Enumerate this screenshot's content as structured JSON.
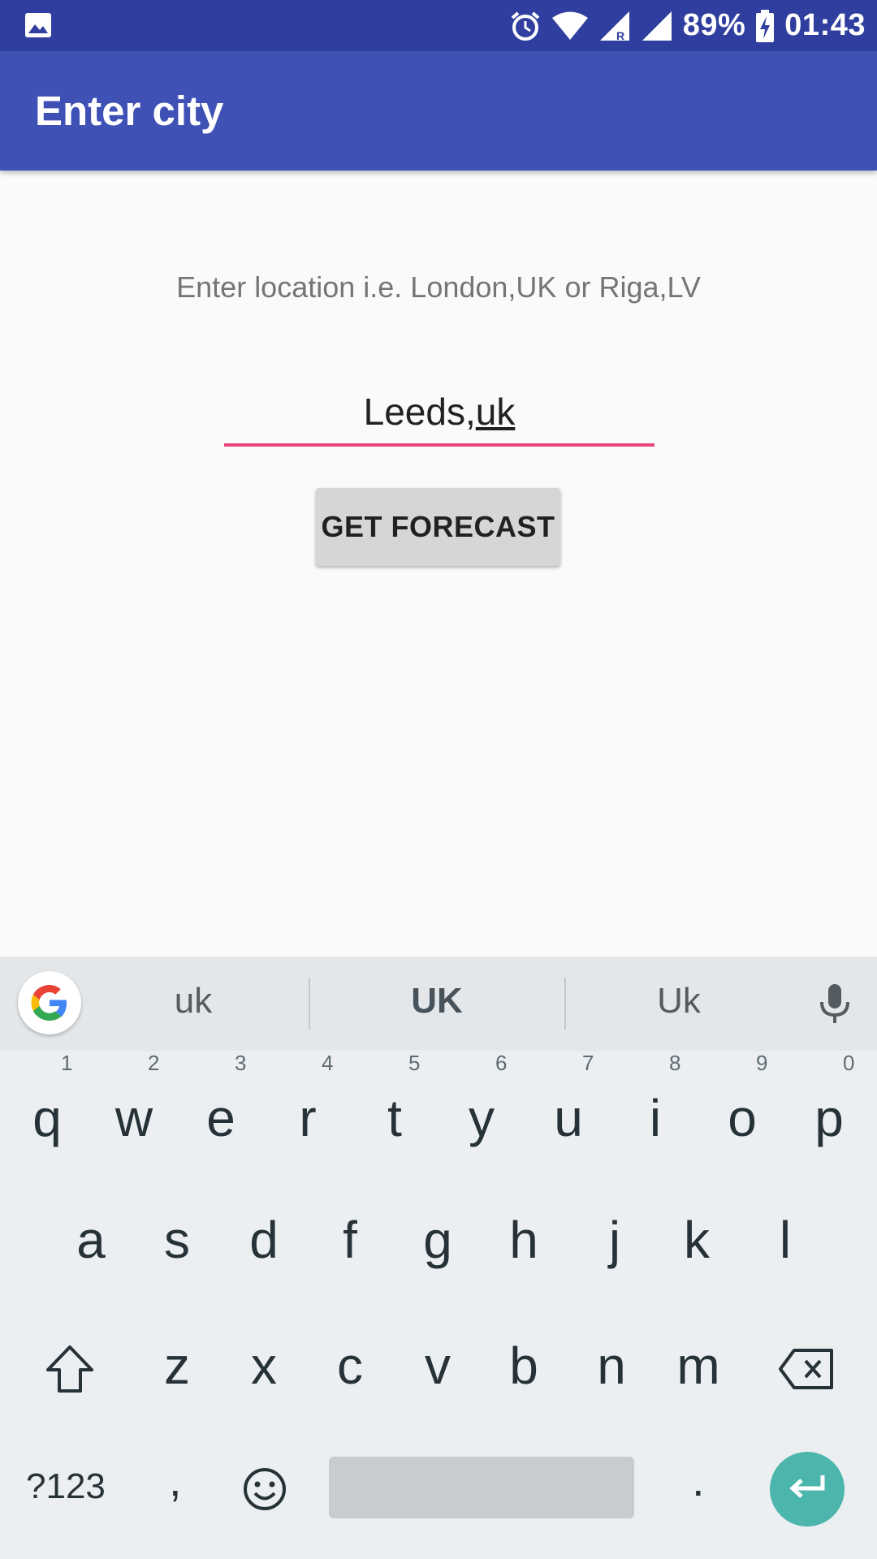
{
  "status_bar": {
    "battery": "89%",
    "time": "01:43",
    "icons": [
      "image-icon",
      "alarm-icon",
      "wifi-icon",
      "cell-signal-roaming-icon",
      "cell-signal-icon",
      "battery-charging-icon"
    ]
  },
  "app_bar": {
    "title": "Enter city"
  },
  "content": {
    "hint": "Enter location i.e. London,UK or Riga,LV",
    "input_value_prefix": "Leeds,",
    "input_value_composing": "uk",
    "forecast_button": "GET FORECAST",
    "accent_color": "#e8467a"
  },
  "keyboard": {
    "suggestions": [
      "uk",
      "UK",
      "Uk"
    ],
    "row1": [
      {
        "key": "q",
        "num": "1"
      },
      {
        "key": "w",
        "num": "2"
      },
      {
        "key": "e",
        "num": "3"
      },
      {
        "key": "r",
        "num": "4"
      },
      {
        "key": "t",
        "num": "5"
      },
      {
        "key": "y",
        "num": "6"
      },
      {
        "key": "u",
        "num": "7"
      },
      {
        "key": "i",
        "num": "8"
      },
      {
        "key": "o",
        "num": "9"
      },
      {
        "key": "p",
        "num": "0"
      }
    ],
    "row2": [
      "a",
      "s",
      "d",
      "f",
      "g",
      "h",
      "j",
      "k",
      "l"
    ],
    "row3": [
      "z",
      "x",
      "c",
      "v",
      "b",
      "n",
      "m"
    ],
    "symbols_key": "?123",
    "comma_key": ",",
    "period_key": ".",
    "enter_color": "#4db6ac"
  }
}
